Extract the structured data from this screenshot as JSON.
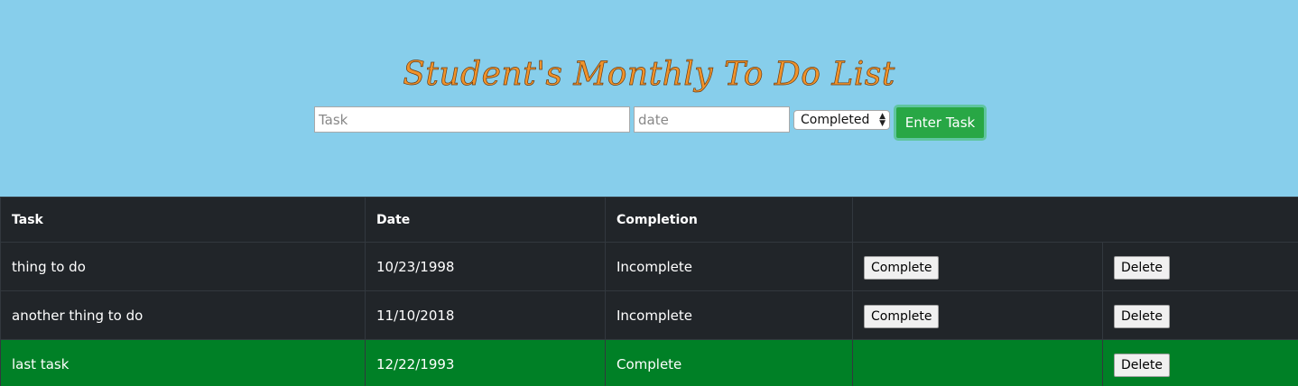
{
  "colors": {
    "header_bg": "#87ceeb",
    "title": "#f0932b",
    "table_bg": "#212529",
    "complete_row_bg": "#008026",
    "enter_button": "#28a745"
  },
  "header": {
    "title": "Student's Monthly To Do List"
  },
  "form": {
    "task_placeholder": "Task",
    "task_value": "",
    "date_placeholder": "date",
    "date_value": "",
    "status_selected": "Completed",
    "enter_label": "Enter Task"
  },
  "table": {
    "headers": {
      "task": "Task",
      "date": "Date",
      "completion": "Completion"
    },
    "rows": [
      {
        "task": "thing to do",
        "date": "10/23/1998",
        "completion": "Incomplete",
        "complete_label": "Complete",
        "delete_label": "Delete"
      },
      {
        "task": "another thing to do",
        "date": "11/10/2018",
        "completion": "Incomplete",
        "complete_label": "Complete",
        "delete_label": "Delete"
      },
      {
        "task": "last task",
        "date": "12/22/1993",
        "completion": "Complete",
        "delete_label": "Delete"
      }
    ]
  }
}
